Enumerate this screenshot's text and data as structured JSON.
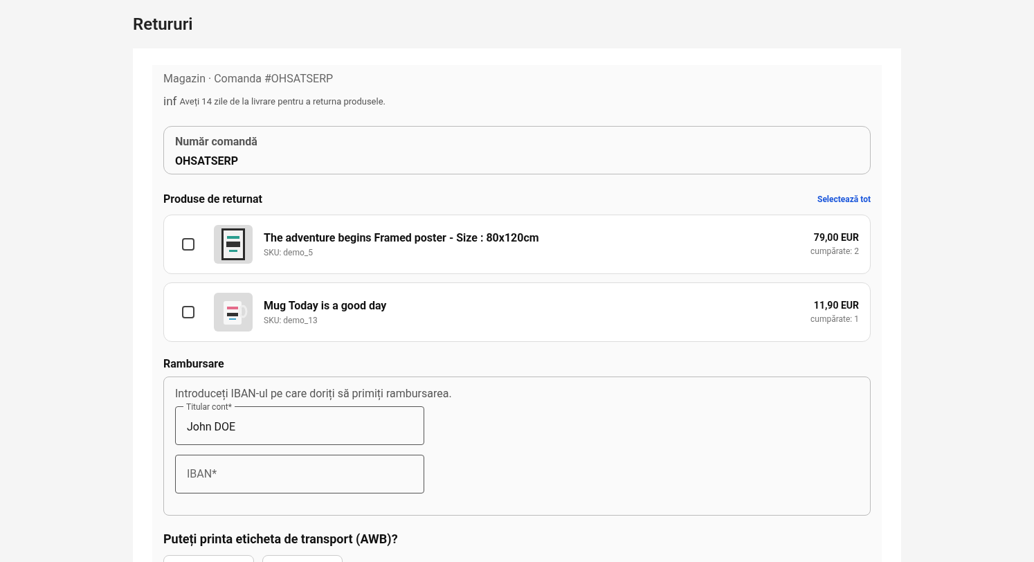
{
  "page_title": "Retururi",
  "order": {
    "subtitle": "Magazin · Comanda #OHSATSERP",
    "info_icon": "inf",
    "info": "Aveți 14 zile de la livrare pentru a returna produsele.",
    "field_label": "Număr comandă",
    "field_value": "OHSATSERP"
  },
  "products_section": {
    "title": "Produse de returnat",
    "select_all": "Selectează tot"
  },
  "products": [
    {
      "name": "The adventure begins Framed poster - Size : 80x120cm",
      "sku": "SKU: demo_5",
      "price": "79,00 EUR",
      "bought": "cumpărate: 2",
      "checked": false,
      "kind": "poster"
    },
    {
      "name": "Mug Today is a good day",
      "sku": "SKU: demo_13",
      "price": "11,90 EUR",
      "bought": "cumpărate: 1",
      "checked": false,
      "kind": "mug"
    }
  ],
  "refund": {
    "title": "Rambursare",
    "hint": "Introduceți IBAN-ul pe care doriți să primiți rambursarea.",
    "fields": [
      {
        "label": "Titular cont*",
        "value": "John DOE"
      },
      {
        "placeholder": "IBAN*"
      }
    ]
  },
  "awb": {
    "title": "Puteți printa eticheta de transport (AWB)?"
  }
}
